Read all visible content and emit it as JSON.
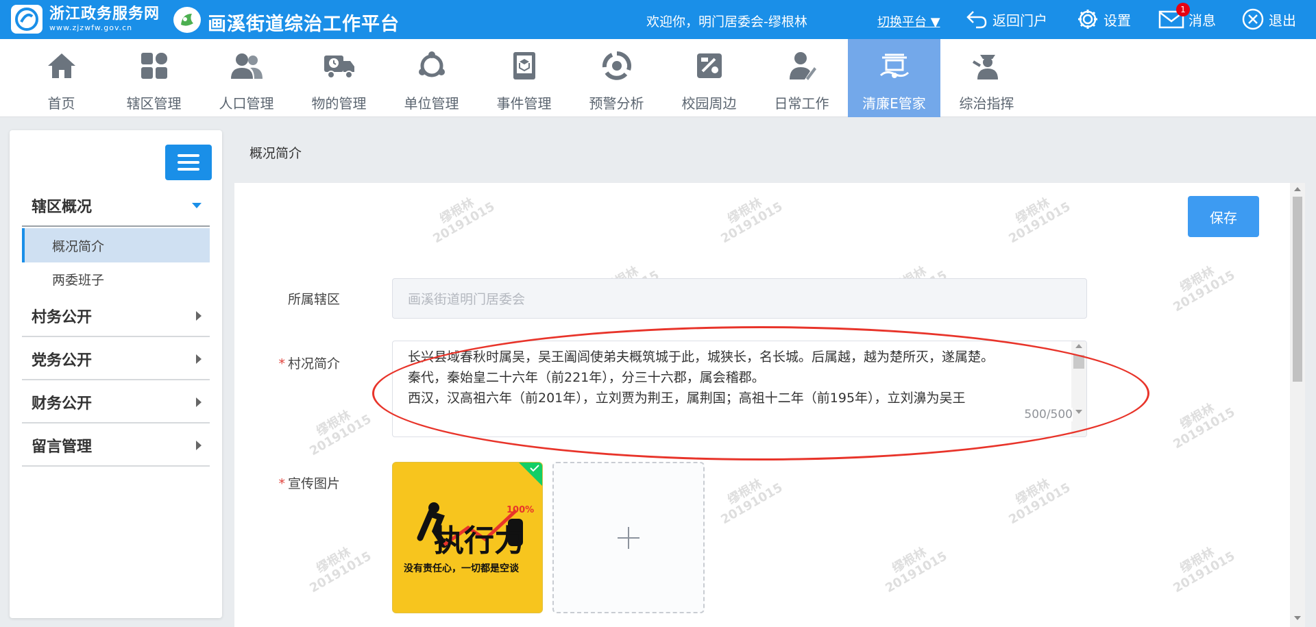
{
  "header": {
    "brand_title": "浙江政务服务网",
    "brand_url": "www.zjzwfw.gov.cn",
    "platform_title": "画溪街道综治工作平台",
    "welcome": "欢迎你，明门居委会-缪根林",
    "switch_label": "切换平台 ▼",
    "back_label": "返回门户",
    "settings_label": "设置",
    "messages_label": "消息",
    "messages_count": "1",
    "logout_label": "退出"
  },
  "nav": {
    "items": [
      {
        "label": "首页",
        "icon": "home-icon"
      },
      {
        "label": "辖区管理",
        "icon": "grid-icon"
      },
      {
        "label": "人口管理",
        "icon": "people-icon"
      },
      {
        "label": "物的管理",
        "icon": "truck-icon"
      },
      {
        "label": "单位管理",
        "icon": "network-icon"
      },
      {
        "label": "事件管理",
        "icon": "book-icon"
      },
      {
        "label": "预警分析",
        "icon": "cycle-icon"
      },
      {
        "label": "校园周边",
        "icon": "school-icon"
      },
      {
        "label": "日常工作",
        "icon": "worker-icon"
      },
      {
        "label": "清廉E管家",
        "icon": "landmark-icon"
      },
      {
        "label": "综治指挥",
        "icon": "commander-icon"
      }
    ],
    "active": "清廉E管家"
  },
  "sidebar": {
    "groups": [
      {
        "label": "辖区概况",
        "open": true
      },
      {
        "label": "村务公开"
      },
      {
        "label": "党务公开"
      },
      {
        "label": "财务公开"
      },
      {
        "label": "留言管理"
      }
    ],
    "sub_items": [
      {
        "label": "概况简介",
        "active": true
      },
      {
        "label": "两委班子"
      }
    ]
  },
  "content": {
    "breadcrumb": "概况简介",
    "save_label": "保存",
    "district_label": "所属辖区",
    "district_placeholder": "画溪街道明门居委会",
    "intro_label": "村况简介",
    "intro_text": "长兴县域春秋时属吴，吴王阖闾使弟夫概筑城于此，城狭长，名长城。后属越，越为楚所灭，遂属楚。\n秦代，秦始皇二十六年（前221年），分三十六郡，属会稽郡。\n西汉，汉高祖六年（前201年），立刘贾为荆王，属荆国；高祖十二年（前195年），立刘濞为吴王",
    "intro_counter": "500/500",
    "image_label": "宣传图片",
    "required_mark": "*",
    "poster": {
      "title": "执行力",
      "percent": "100%",
      "caption": "没有责任心，一切都是空谈"
    },
    "watermark_name": "缪根林",
    "watermark_date": "20191015"
  },
  "colors": {
    "primary": "#1a8fe8",
    "nav_active": "#73a8ea",
    "required": "#e0403a",
    "highlight_oval": "#e8342a"
  }
}
